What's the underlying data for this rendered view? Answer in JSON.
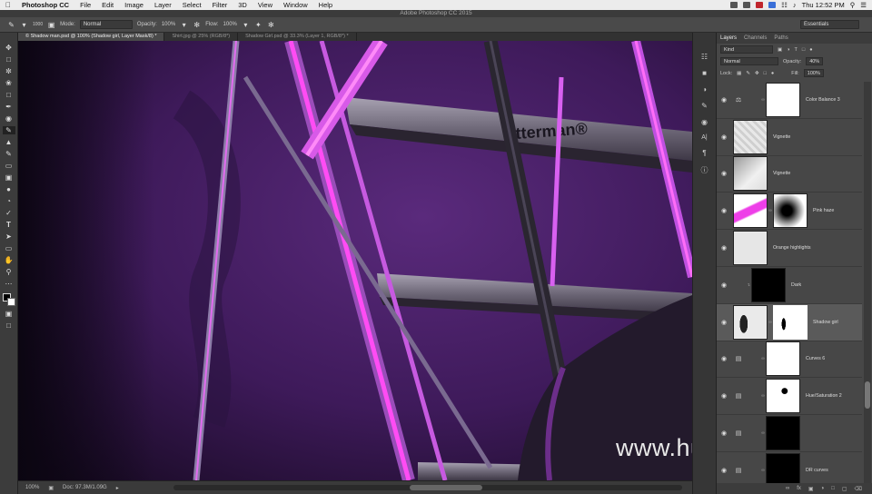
{
  "menubar": {
    "app": "Photoshop CC",
    "items": [
      "File",
      "Edit",
      "Image",
      "Layer",
      "Select",
      "Filter",
      "3D",
      "View",
      "Window",
      "Help"
    ],
    "clock": "Thu 12:52 PM"
  },
  "window_title": "Adobe Photoshop CC 2015",
  "options": {
    "brush_size": "1000",
    "mode_label": "Mode:",
    "mode_value": "Normal",
    "opacity_label": "Opacity:",
    "opacity_value": "100%",
    "flow_label": "Flow:",
    "flow_value": "100%",
    "workspace": "Essentials"
  },
  "tabs": [
    "© Shadow man.psd @ 100% (Shadow girl, Layer Mask/8) *",
    "Shirt.jpg @ 25% (RGB/8*)",
    "Shadow Girl.psd @ 33.3% (Layer 1, RGB/8*) *"
  ],
  "ladder_label": "tterman®",
  "status": {
    "zoom": "100%",
    "doc": "Doc: 97.3M/1.09G"
  },
  "layers_panel": {
    "tabs": [
      "Layers",
      "Channels",
      "Paths"
    ],
    "kind": "Kind",
    "blend": "Normal",
    "opacity_label": "Opacity:",
    "opacity_value": "40%",
    "lock_label": "Lock:",
    "fill_label": "Fill:",
    "fill_value": "100%",
    "layers": [
      {
        "name": "Color Balance 3"
      },
      {
        "name": "Vignette"
      },
      {
        "name": "Vignette"
      },
      {
        "name": "Pink haze"
      },
      {
        "name": "Orange highlights"
      },
      {
        "name": "Dark"
      },
      {
        "name": "Shadow girl"
      },
      {
        "name": "Curves 6"
      },
      {
        "name": "Hue/Saturation 2"
      },
      {
        "name": ""
      },
      {
        "name": "DR curves"
      }
    ]
  },
  "watermark": "www.hunls.com"
}
